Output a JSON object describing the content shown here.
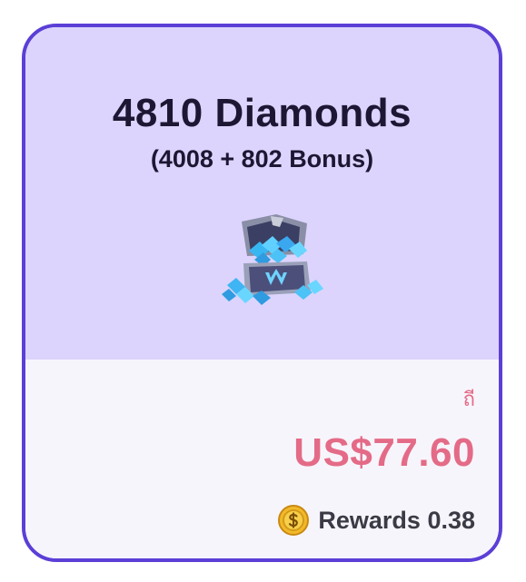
{
  "product": {
    "title": "4810 Diamonds",
    "subtitle": "(4008 + 802 Bonus)",
    "image_icon": "diamond-chest"
  },
  "purchase": {
    "tag_mark": "ถี",
    "price": "US$77.60",
    "rewards_icon": "coin-icon",
    "rewards_text": "Rewards 0.38"
  },
  "colors": {
    "border": "#5b3fd6",
    "top_background": "#dcd4fd",
    "bottom_background": "#f7f5fc",
    "price": "#e46b87",
    "title": "#1e1733"
  }
}
